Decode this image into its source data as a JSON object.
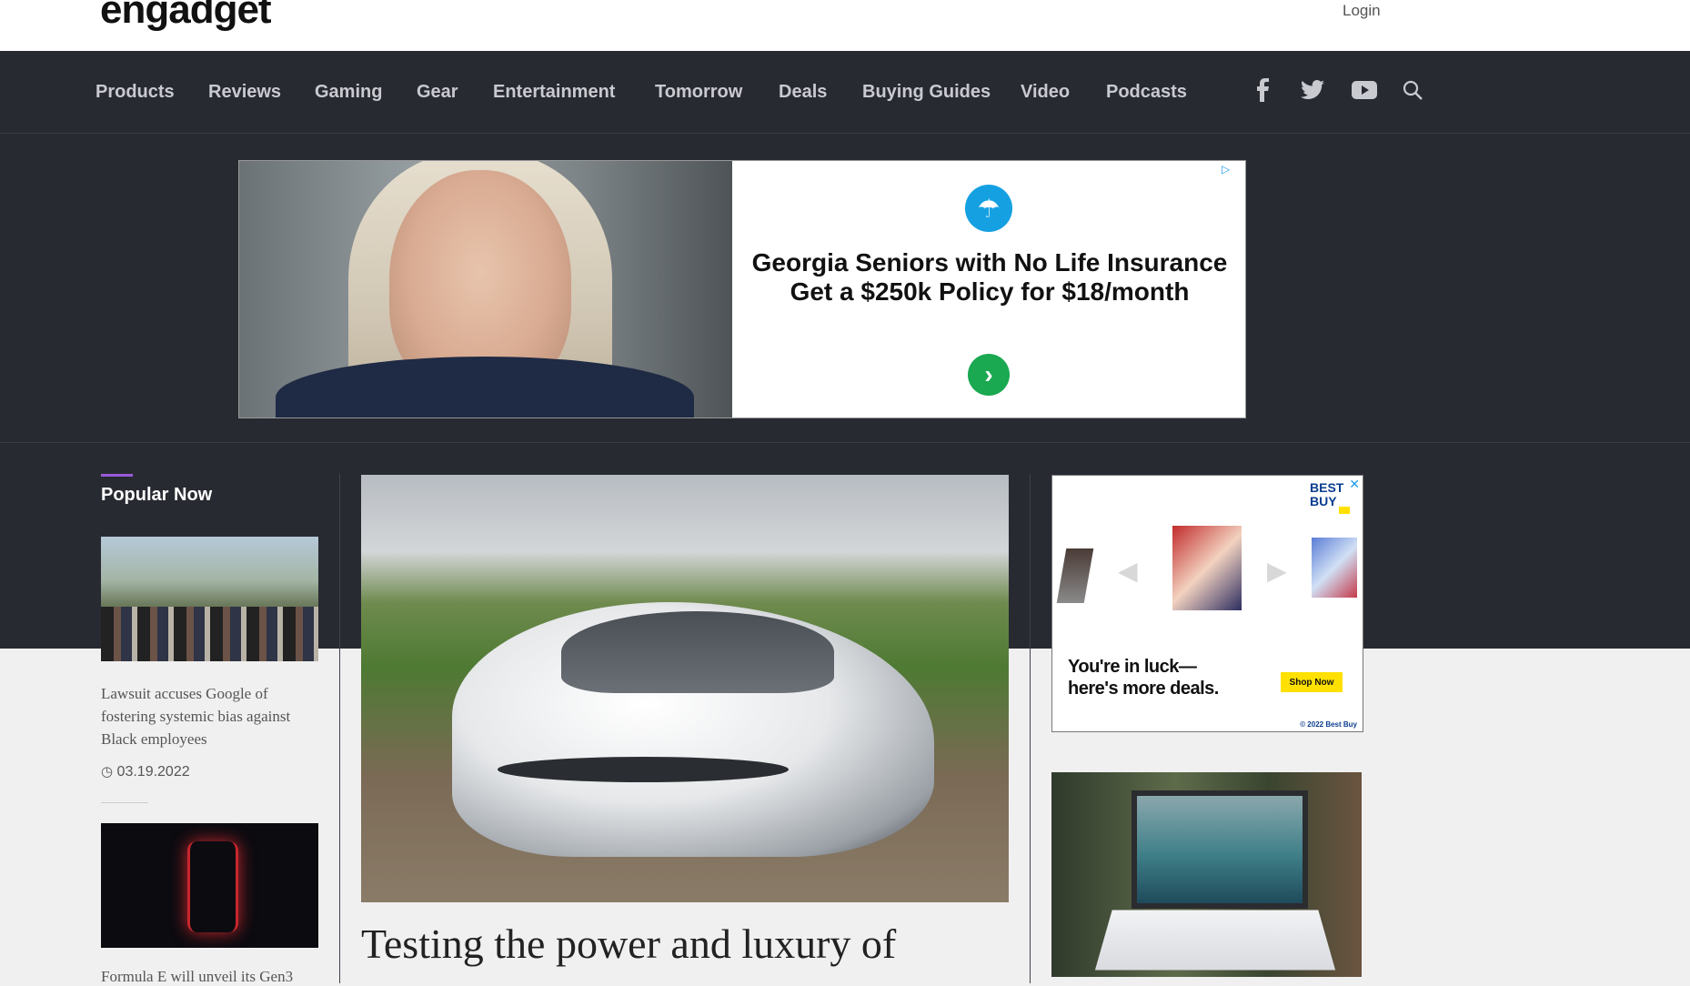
{
  "header": {
    "logo_text": "engadget",
    "login_label": "Login"
  },
  "nav": {
    "items": [
      "Products",
      "Reviews",
      "Gaming",
      "Gear",
      "Entertainment",
      "Tomorrow",
      "Deals",
      "Buying Guides",
      "Video",
      "Podcasts"
    ],
    "icons": [
      "facebook-icon",
      "twitter-icon",
      "youtube-icon",
      "search-icon"
    ]
  },
  "ad_banner": {
    "headline": "Georgia Seniors with No Life Insurance Get a $250k Policy for $18/month"
  },
  "popular": {
    "title": "Popular Now",
    "items": [
      {
        "headline": "Lawsuit accuses Google of fostering systemic bias against Black employees",
        "date": "03.19.2022"
      },
      {
        "headline": "Formula E will unveil its Gen3"
      }
    ]
  },
  "hero": {
    "title": "Testing the power and luxury of"
  },
  "bestbuy_ad": {
    "logo": "BEST BUY",
    "text_line1": "You're in luck—",
    "text_line2": "here's more deals.",
    "shop_label": "Shop Now",
    "copyright": "© 2022 Best Buy"
  },
  "colors": {
    "nav_bg": "#282a32",
    "accent": "#9b5ad8",
    "bestbuy_yellow": "#ffe000"
  }
}
